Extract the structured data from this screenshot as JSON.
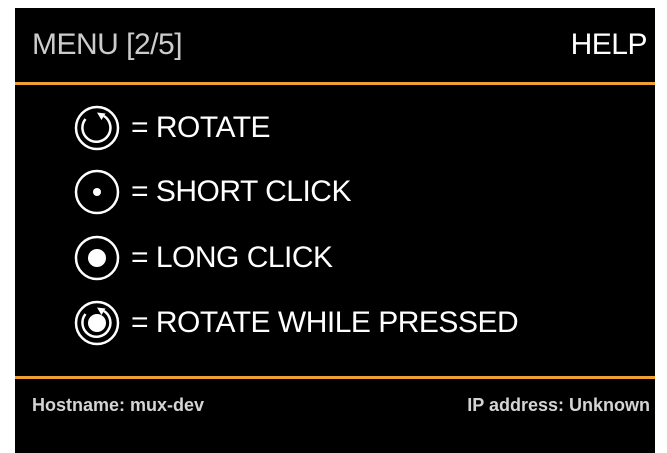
{
  "header": {
    "menu": "MENU [2/5]",
    "help": "HELP"
  },
  "legend": [
    {
      "icon": "rotate-icon",
      "label": "= ROTATE"
    },
    {
      "icon": "short-click-icon",
      "label": "= SHORT CLICK"
    },
    {
      "icon": "long-click-icon",
      "label": "= LONG CLICK"
    },
    {
      "icon": "rotate-while-pressed-icon",
      "label": "= ROTATE WHILE PRESSED"
    }
  ],
  "footer": {
    "hostname": "Hostname: mux-dev",
    "ip": "IP address: Unknown"
  },
  "colors": {
    "background": "#000000",
    "accent": "#f0a030",
    "text": "#ffffff",
    "muted": "#cccccc"
  }
}
